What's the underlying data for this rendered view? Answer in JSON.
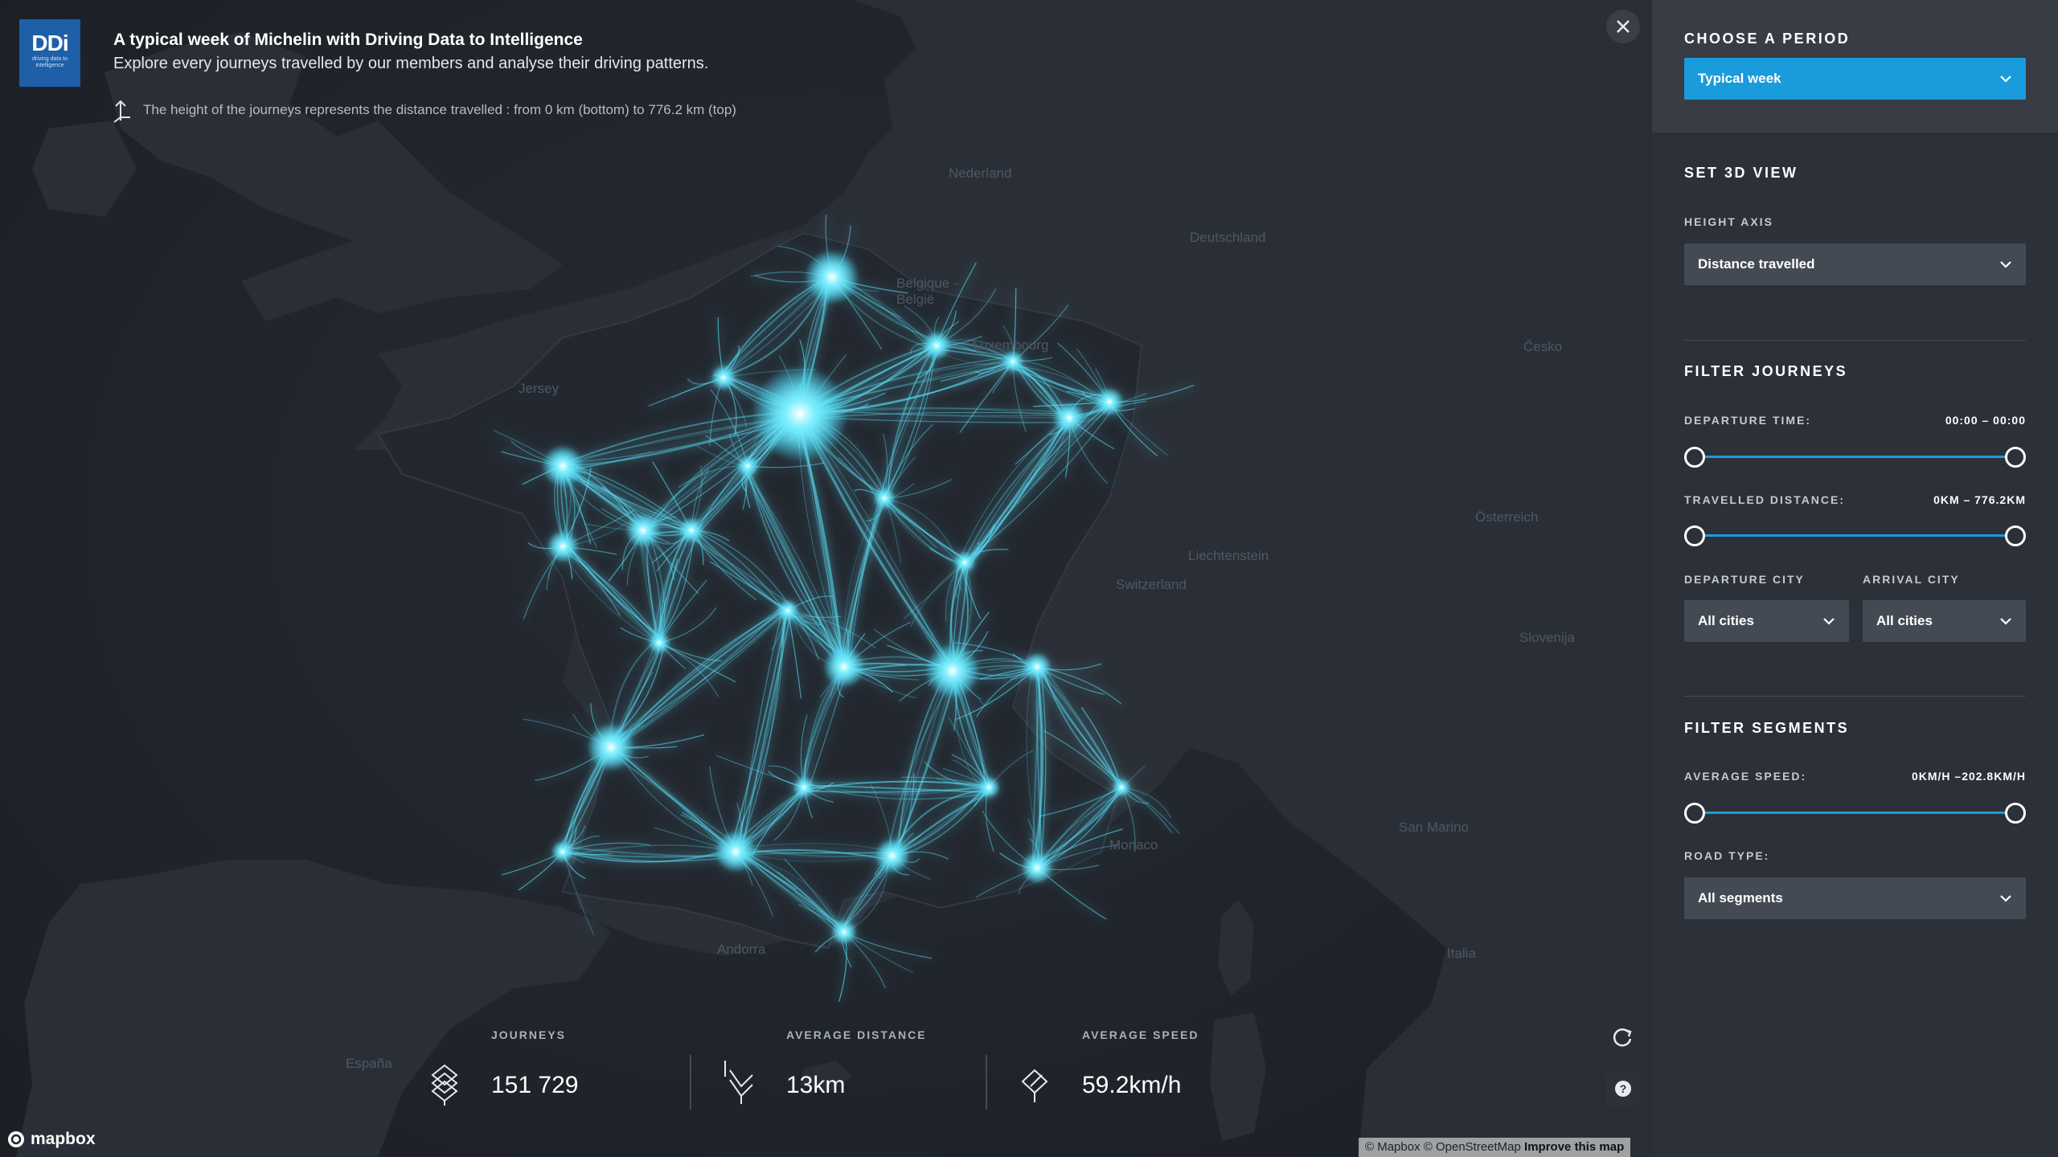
{
  "header": {
    "logo_text": "DDi",
    "logo_subtext": "driving data to intelligence",
    "title": "A typical week of Michelin with Driving Data to Intelligence",
    "subtitle": "Explore every journeys travelled by our members and analyse their driving patterns.",
    "height_note": "The height of the journeys represents the distance travelled : from 0 km (bottom) to 776.2 km (top)"
  },
  "map": {
    "places": [
      "Nederland",
      "Deutschland",
      "Belgique - België",
      "Luxembourg",
      "Česko",
      "Jersey",
      "Liechtenstein",
      "Switzerland",
      "Österreich",
      "Slovenija",
      "San Marino",
      "Monaco",
      "Italia",
      "Andorra",
      "España"
    ],
    "journey_color": "#5ee6ff",
    "land_color": "#2a2f37",
    "sea_color": "#1e2229",
    "attribution": "© Mapbox © OpenStreetMap",
    "improve_link": "Improve this map",
    "mapbox_label": "mapbox"
  },
  "stats": {
    "journeys_label": "JOURNEYS",
    "journeys_value": "151 729",
    "avg_distance_label": "AVERAGE DISTANCE",
    "avg_distance_value": "13km",
    "avg_speed_label": "AVERAGE SPEED",
    "avg_speed_value": "59.2km/h"
  },
  "controls": {
    "close_icon": "close-icon",
    "refresh_icon": "refresh-icon",
    "help_icon": "help-icon",
    "help_glyph": "?"
  },
  "panel": {
    "period": {
      "title": "CHOOSE A PERIOD",
      "selected": "Typical week",
      "accent": "#1a9bdb"
    },
    "view3d": {
      "title": "SET 3D VIEW",
      "height_axis_label": "HEIGHT AXIS",
      "height_axis_value": "Distance travelled"
    },
    "journeys": {
      "title": "FILTER JOURNEYS",
      "departure_time_label": "DEPARTURE TIME:",
      "departure_time_value": "00:00 – 00:00",
      "travelled_distance_label": "TRAVELLED DISTANCE:",
      "travelled_distance_value": "0KM – 776.2KM",
      "departure_city_label": "DEPARTURE CITY",
      "departure_city_value": "All cities",
      "arrival_city_label": "ARRIVAL CITY",
      "arrival_city_value": "All cities"
    },
    "segments": {
      "title": "FILTER SEGMENTS",
      "avg_speed_label": "AVERAGE SPEED:",
      "avg_speed_value": "0KM/H –202.8KM/H",
      "road_type_label": "ROAD TYPE:",
      "road_type_value": "All segments"
    }
  }
}
